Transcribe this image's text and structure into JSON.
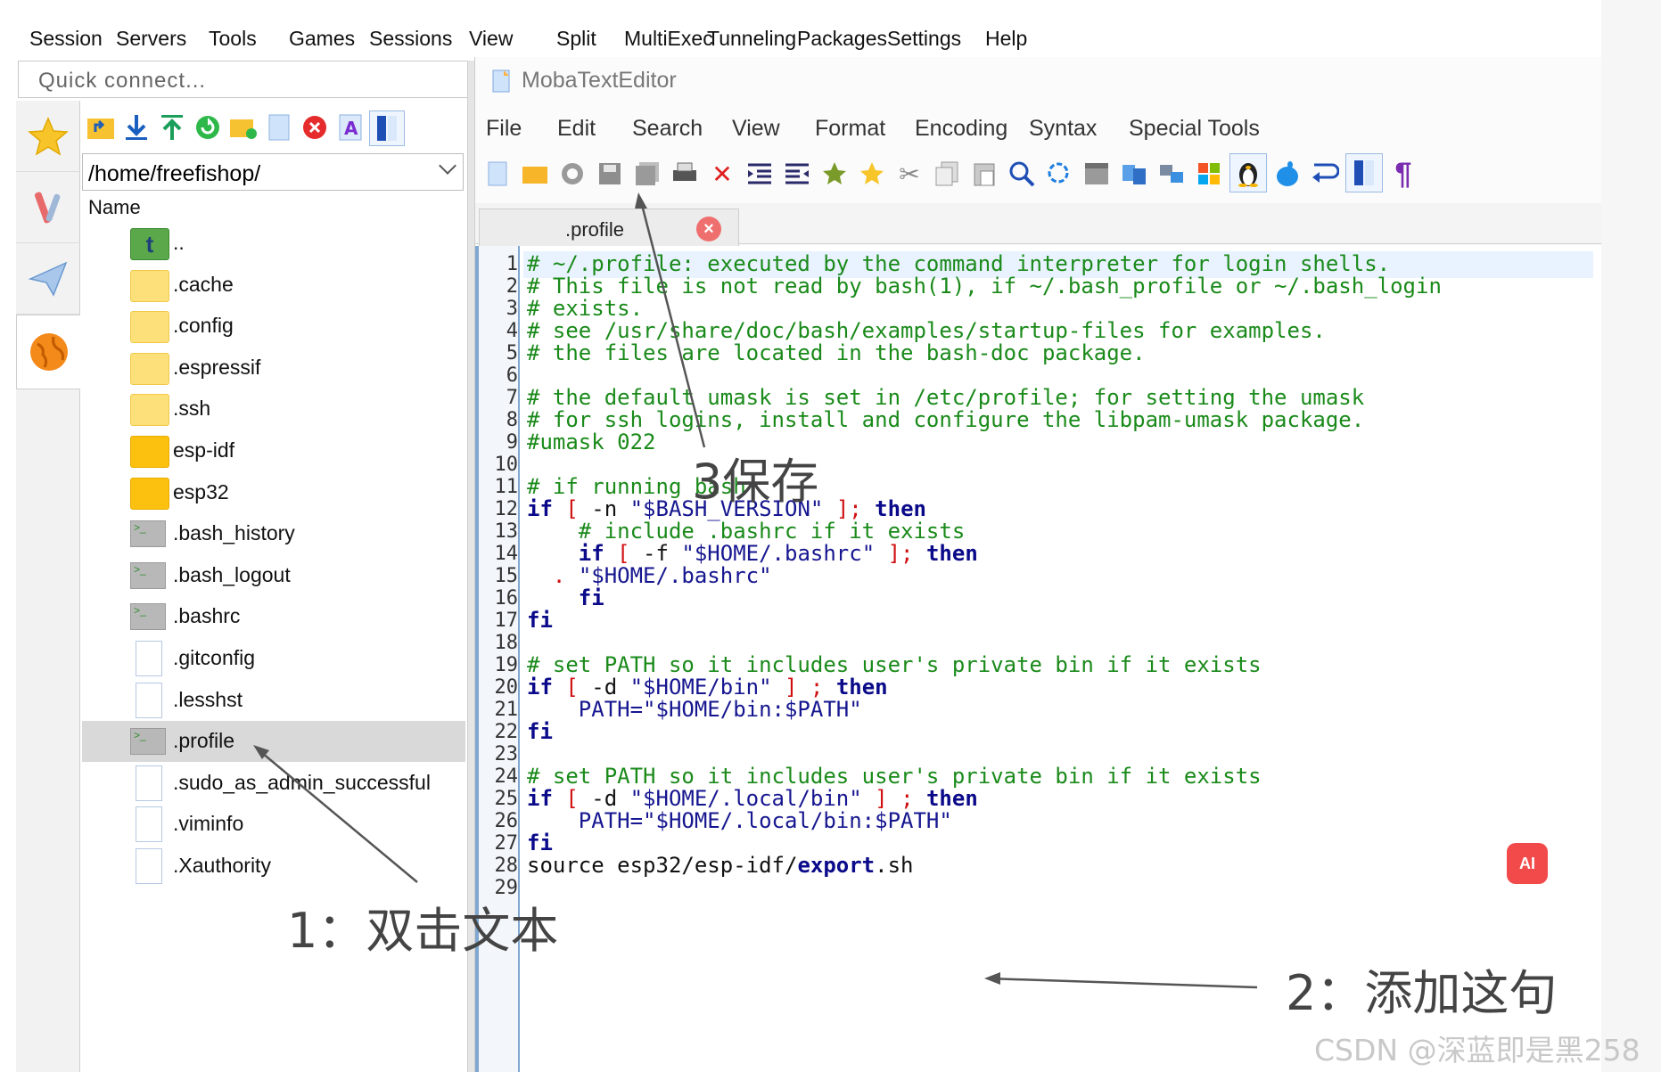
{
  "menubar": [
    "Session",
    "Servers",
    "Tools",
    "Games",
    "Sessions",
    "View",
    "Split",
    "MultiExec",
    "Tunneling",
    "Packages",
    "Settings",
    "Help"
  ],
  "left_panel": {
    "quick_connect_placeholder": "Quick connect...",
    "path": "/home/freefishop/",
    "column_header": "Name",
    "files": [
      {
        "name": "..",
        "kind": "parent"
      },
      {
        "name": ".cache",
        "kind": "folder"
      },
      {
        "name": ".config",
        "kind": "folder"
      },
      {
        "name": ".espressif",
        "kind": "folder"
      },
      {
        "name": ".ssh",
        "kind": "folder"
      },
      {
        "name": "esp-idf",
        "kind": "folder-dark"
      },
      {
        "name": "esp32",
        "kind": "folder-dark"
      },
      {
        "name": ".bash_history",
        "kind": "term"
      },
      {
        "name": ".bash_logout",
        "kind": "term"
      },
      {
        "name": ".bashrc",
        "kind": "term"
      },
      {
        "name": ".gitconfig",
        "kind": "doc"
      },
      {
        "name": ".lesshst",
        "kind": "doc"
      },
      {
        "name": ".profile",
        "kind": "term",
        "selected": true
      },
      {
        "name": ".sudo_as_admin_successful",
        "kind": "doc"
      },
      {
        "name": ".viminfo",
        "kind": "doc"
      },
      {
        "name": ".Xauthority",
        "kind": "doc"
      }
    ]
  },
  "editor": {
    "title": "MobaTextEditor",
    "menus": [
      "File",
      "Edit",
      "Search",
      "View",
      "Format",
      "Encoding",
      "Syntax",
      "Special Tools"
    ],
    "tab_label": ".profile",
    "tab_close": "×",
    "lines": [
      [
        [
          "c",
          "# ~/.profile: executed by the command interpreter for login shells."
        ]
      ],
      [
        [
          "c",
          "# This file is not read by bash(1), if ~/.bash_profile or ~/.bash_login"
        ]
      ],
      [
        [
          "c",
          "# exists."
        ]
      ],
      [
        [
          "c",
          "# see /usr/share/doc/bash/examples/startup-files for examples."
        ]
      ],
      [
        [
          "c",
          "# the files are located in the bash-doc package."
        ]
      ],
      [],
      [
        [
          "c",
          "# the default umask is set in /etc/profile; for setting the umask"
        ]
      ],
      [
        [
          "c",
          "# for ssh logins, install and configure the libpam-umask package."
        ]
      ],
      [
        [
          "c",
          "#umask 022"
        ]
      ],
      [],
      [
        [
          "c",
          "# if running bash"
        ]
      ],
      [
        [
          "k",
          "if"
        ],
        [
          "p",
          " "
        ],
        [
          "o",
          "["
        ],
        [
          "p",
          " -n "
        ],
        [
          "s",
          "\"$BASH_VERSION\""
        ],
        [
          "p",
          " "
        ],
        [
          "o",
          "];"
        ],
        [
          "p",
          " "
        ],
        [
          "k",
          "then"
        ]
      ],
      [
        [
          "p",
          "    "
        ],
        [
          "c",
          "# include .bashrc if it exists"
        ]
      ],
      [
        [
          "p",
          "    "
        ],
        [
          "k",
          "if"
        ],
        [
          "p",
          " "
        ],
        [
          "o",
          "["
        ],
        [
          "p",
          " -f "
        ],
        [
          "s",
          "\"$HOME/.bashrc\""
        ],
        [
          "p",
          " "
        ],
        [
          "o",
          "];"
        ],
        [
          "p",
          " "
        ],
        [
          "k",
          "then"
        ]
      ],
      [
        [
          "p",
          "  "
        ],
        [
          "o",
          "."
        ],
        [
          "p",
          " "
        ],
        [
          "s",
          "\"$HOME/.bashrc\""
        ]
      ],
      [
        [
          "p",
          "    "
        ],
        [
          "k",
          "fi"
        ]
      ],
      [
        [
          "k",
          "fi"
        ]
      ],
      [],
      [
        [
          "c",
          "# set PATH so it includes user's private bin if it exists"
        ]
      ],
      [
        [
          "k",
          "if"
        ],
        [
          "p",
          " "
        ],
        [
          "o",
          "["
        ],
        [
          "p",
          " -d "
        ],
        [
          "s",
          "\"$HOME/bin\""
        ],
        [
          "p",
          " "
        ],
        [
          "o",
          "]"
        ],
        [
          "p",
          " "
        ],
        [
          "o",
          ";"
        ],
        [
          "p",
          " "
        ],
        [
          "k",
          "then"
        ]
      ],
      [
        [
          "p",
          "    "
        ],
        [
          "s",
          "PATH=\"$HOME/bin:$PATH\""
        ]
      ],
      [
        [
          "k",
          "fi"
        ]
      ],
      [],
      [
        [
          "c",
          "# set PATH so it includes user's private bin if it exists"
        ]
      ],
      [
        [
          "k",
          "if"
        ],
        [
          "p",
          " "
        ],
        [
          "o",
          "["
        ],
        [
          "p",
          " -d "
        ],
        [
          "s",
          "\"$HOME/.local/bin\""
        ],
        [
          "p",
          " "
        ],
        [
          "o",
          "]"
        ],
        [
          "p",
          " "
        ],
        [
          "o",
          ";"
        ],
        [
          "p",
          " "
        ],
        [
          "k",
          "then"
        ]
      ],
      [
        [
          "p",
          "    "
        ],
        [
          "s",
          "PATH=\"$HOME/.local/bin:$PATH\""
        ]
      ],
      [
        [
          "k",
          "fi"
        ]
      ],
      [
        [
          "p",
          "source esp32/esp-idf/"
        ],
        [
          "k",
          "export"
        ],
        [
          "p",
          ".sh"
        ]
      ],
      []
    ]
  },
  "annotations": {
    "step1": "1：双击文本",
    "step2": "2：添加这句",
    "step3": "3保存"
  },
  "ai_badge": "AI",
  "watermark": "CSDN @深蓝即是黑258",
  "colors": {
    "comment": "#1a8a1a",
    "keyword": "#0a0a8a",
    "operator": "#d01010",
    "gutter_border": "#7fa7cf",
    "selected_row": "#d9d9d9",
    "ai_badge": "#f24a4a"
  }
}
